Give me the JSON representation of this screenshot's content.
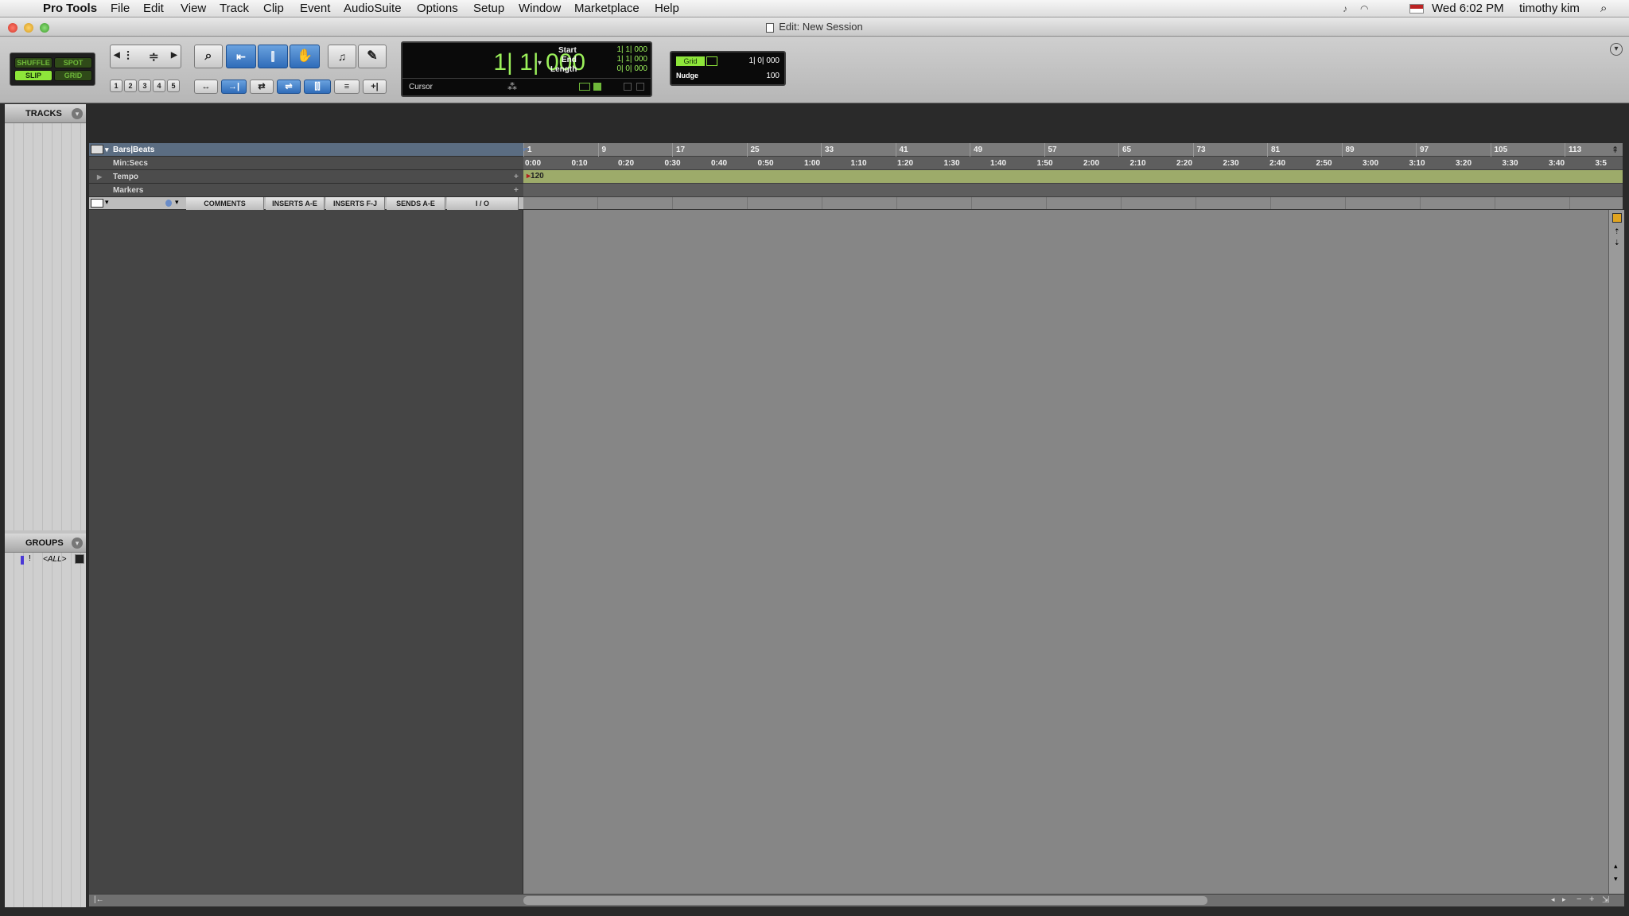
{
  "menubar": {
    "app": "Pro Tools",
    "items": [
      "File",
      "Edit",
      "View",
      "Track",
      "Clip",
      "Event",
      "AudioSuite",
      "Options",
      "Setup",
      "Window",
      "Marketplace",
      "Help"
    ],
    "clock": "Wed 6:02 PM",
    "user": "timothy kim"
  },
  "window": {
    "title": "Edit: New Session"
  },
  "modes": {
    "shuffle": "SHUFFLE",
    "spot": "SPOT",
    "slip": "SLIP",
    "grid": "GRID"
  },
  "zoom_presets": [
    "1",
    "2",
    "3",
    "4",
    "5"
  ],
  "counter": {
    "main": "1| 1| 000",
    "start_label": "Start",
    "end_label": "End",
    "length_label": "Length",
    "start": "1| 1| 000",
    "end": "1| 1| 000",
    "length": "0| 0| 000",
    "cursor_label": "Cursor"
  },
  "grid": {
    "label": "Grid",
    "value": "1| 0| 000",
    "nudge_label": "Nudge",
    "nudge_value": "100"
  },
  "sidebar": {
    "tracks": "TRACKS",
    "groups": "GROUPS",
    "group_item": "<ALL>",
    "group_flag": "!"
  },
  "ruler_labels": {
    "bars": "Bars|Beats",
    "minsecs": "Min:Secs",
    "tempo": "Tempo",
    "markers": "Markers"
  },
  "columns": [
    "COMMENTS",
    "INSERTS A-E",
    "INSERTS F-J",
    "SENDS A-E",
    "I / O"
  ],
  "bars": [
    "1",
    "9",
    "17",
    "25",
    "33",
    "41",
    "49",
    "57",
    "65",
    "73",
    "81",
    "89",
    "97",
    "105",
    "113"
  ],
  "minsecs": [
    "0:00",
    "0:10",
    "0:20",
    "0:30",
    "0:40",
    "0:50",
    "1:00",
    "1:10",
    "1:20",
    "1:30",
    "1:40",
    "1:50",
    "2:00",
    "2:10",
    "2:20",
    "2:30",
    "2:40",
    "2:50",
    "3:00",
    "3:10",
    "3:20",
    "3:30",
    "3:40",
    "3:5"
  ],
  "tempo_value": "120",
  "colors": {
    "lcd_green": "#9bf05a",
    "tempo_band": "#9dab6a",
    "edit_bg": "#868686",
    "tracklist_bg": "#454545"
  }
}
